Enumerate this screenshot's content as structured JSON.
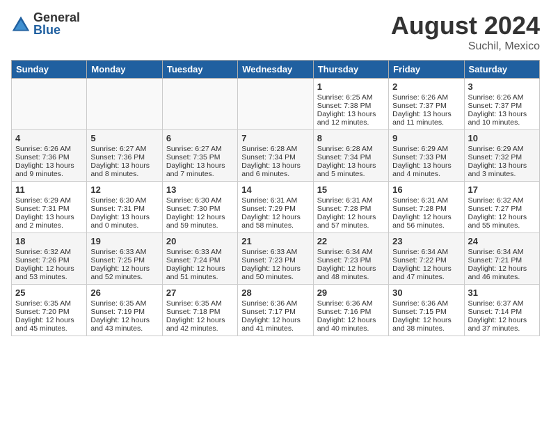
{
  "header": {
    "logo_general": "General",
    "logo_blue": "Blue",
    "month_year": "August 2024",
    "location": "Suchil, Mexico"
  },
  "weekdays": [
    "Sunday",
    "Monday",
    "Tuesday",
    "Wednesday",
    "Thursday",
    "Friday",
    "Saturday"
  ],
  "weeks": [
    [
      {
        "day": "",
        "content": ""
      },
      {
        "day": "",
        "content": ""
      },
      {
        "day": "",
        "content": ""
      },
      {
        "day": "",
        "content": ""
      },
      {
        "day": "1",
        "content": "Sunrise: 6:25 AM\nSunset: 7:38 PM\nDaylight: 13 hours and 12 minutes."
      },
      {
        "day": "2",
        "content": "Sunrise: 6:26 AM\nSunset: 7:37 PM\nDaylight: 13 hours and 11 minutes."
      },
      {
        "day": "3",
        "content": "Sunrise: 6:26 AM\nSunset: 7:37 PM\nDaylight: 13 hours and 10 minutes."
      }
    ],
    [
      {
        "day": "4",
        "content": "Sunrise: 6:26 AM\nSunset: 7:36 PM\nDaylight: 13 hours and 9 minutes."
      },
      {
        "day": "5",
        "content": "Sunrise: 6:27 AM\nSunset: 7:36 PM\nDaylight: 13 hours and 8 minutes."
      },
      {
        "day": "6",
        "content": "Sunrise: 6:27 AM\nSunset: 7:35 PM\nDaylight: 13 hours and 7 minutes."
      },
      {
        "day": "7",
        "content": "Sunrise: 6:28 AM\nSunset: 7:34 PM\nDaylight: 13 hours and 6 minutes."
      },
      {
        "day": "8",
        "content": "Sunrise: 6:28 AM\nSunset: 7:34 PM\nDaylight: 13 hours and 5 minutes."
      },
      {
        "day": "9",
        "content": "Sunrise: 6:29 AM\nSunset: 7:33 PM\nDaylight: 13 hours and 4 minutes."
      },
      {
        "day": "10",
        "content": "Sunrise: 6:29 AM\nSunset: 7:32 PM\nDaylight: 13 hours and 3 minutes."
      }
    ],
    [
      {
        "day": "11",
        "content": "Sunrise: 6:29 AM\nSunset: 7:31 PM\nDaylight: 13 hours and 2 minutes."
      },
      {
        "day": "12",
        "content": "Sunrise: 6:30 AM\nSunset: 7:31 PM\nDaylight: 13 hours and 0 minutes."
      },
      {
        "day": "13",
        "content": "Sunrise: 6:30 AM\nSunset: 7:30 PM\nDaylight: 12 hours and 59 minutes."
      },
      {
        "day": "14",
        "content": "Sunrise: 6:31 AM\nSunset: 7:29 PM\nDaylight: 12 hours and 58 minutes."
      },
      {
        "day": "15",
        "content": "Sunrise: 6:31 AM\nSunset: 7:28 PM\nDaylight: 12 hours and 57 minutes."
      },
      {
        "day": "16",
        "content": "Sunrise: 6:31 AM\nSunset: 7:28 PM\nDaylight: 12 hours and 56 minutes."
      },
      {
        "day": "17",
        "content": "Sunrise: 6:32 AM\nSunset: 7:27 PM\nDaylight: 12 hours and 55 minutes."
      }
    ],
    [
      {
        "day": "18",
        "content": "Sunrise: 6:32 AM\nSunset: 7:26 PM\nDaylight: 12 hours and 53 minutes."
      },
      {
        "day": "19",
        "content": "Sunrise: 6:33 AM\nSunset: 7:25 PM\nDaylight: 12 hours and 52 minutes."
      },
      {
        "day": "20",
        "content": "Sunrise: 6:33 AM\nSunset: 7:24 PM\nDaylight: 12 hours and 51 minutes."
      },
      {
        "day": "21",
        "content": "Sunrise: 6:33 AM\nSunset: 7:23 PM\nDaylight: 12 hours and 50 minutes."
      },
      {
        "day": "22",
        "content": "Sunrise: 6:34 AM\nSunset: 7:23 PM\nDaylight: 12 hours and 48 minutes."
      },
      {
        "day": "23",
        "content": "Sunrise: 6:34 AM\nSunset: 7:22 PM\nDaylight: 12 hours and 47 minutes."
      },
      {
        "day": "24",
        "content": "Sunrise: 6:34 AM\nSunset: 7:21 PM\nDaylight: 12 hours and 46 minutes."
      }
    ],
    [
      {
        "day": "25",
        "content": "Sunrise: 6:35 AM\nSunset: 7:20 PM\nDaylight: 12 hours and 45 minutes."
      },
      {
        "day": "26",
        "content": "Sunrise: 6:35 AM\nSunset: 7:19 PM\nDaylight: 12 hours and 43 minutes."
      },
      {
        "day": "27",
        "content": "Sunrise: 6:35 AM\nSunset: 7:18 PM\nDaylight: 12 hours and 42 minutes."
      },
      {
        "day": "28",
        "content": "Sunrise: 6:36 AM\nSunset: 7:17 PM\nDaylight: 12 hours and 41 minutes."
      },
      {
        "day": "29",
        "content": "Sunrise: 6:36 AM\nSunset: 7:16 PM\nDaylight: 12 hours and 40 minutes."
      },
      {
        "day": "30",
        "content": "Sunrise: 6:36 AM\nSunset: 7:15 PM\nDaylight: 12 hours and 38 minutes."
      },
      {
        "day": "31",
        "content": "Sunrise: 6:37 AM\nSunset: 7:14 PM\nDaylight: 12 hours and 37 minutes."
      }
    ]
  ]
}
